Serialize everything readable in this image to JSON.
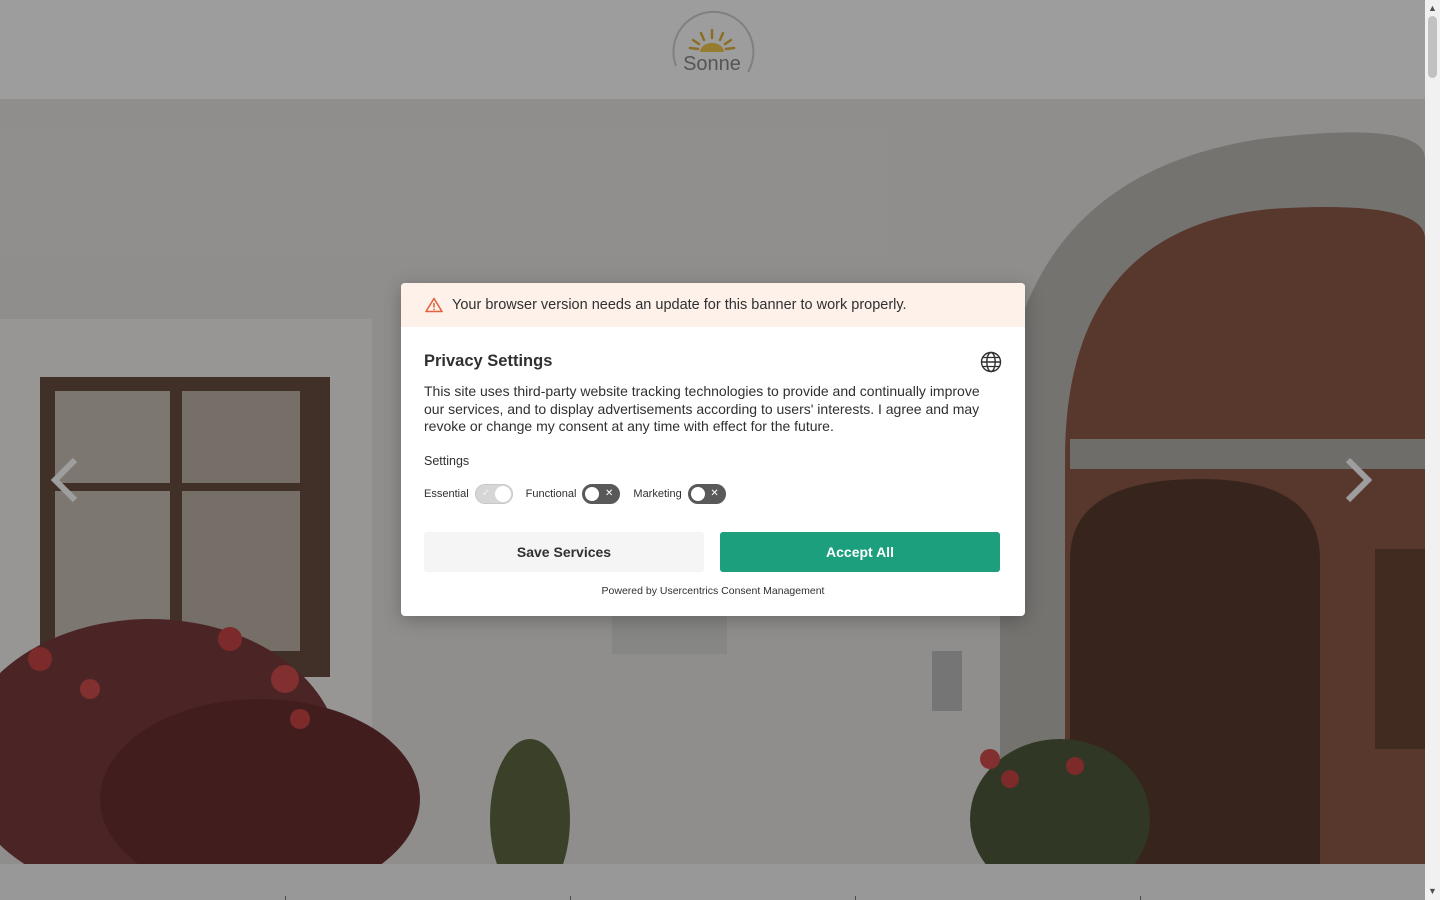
{
  "site": {
    "logo_text": "Sonne"
  },
  "banner": {
    "warning_text": "Your browser version needs an update for this banner to work properly.",
    "title": "Privacy Settings",
    "description": "This site uses third-party website tracking technologies to provide and continually improve our services, and to display advertisements according to users' interests. I agree and may revoke or change my consent at any time with effect for the future.",
    "settings_label": "Settings",
    "toggles": [
      {
        "label": "Essential",
        "state": "on",
        "disabled": true
      },
      {
        "label": "Functional",
        "state": "off",
        "disabled": false
      },
      {
        "label": "Marketing",
        "state": "off",
        "disabled": false
      }
    ],
    "save_label": "Save Services",
    "accept_label": "Accept All",
    "powered_by": "Powered by Usercentrics Consent Management"
  },
  "colors": {
    "accent": "#1b9f7c",
    "warning_bg": "#fdf1ea",
    "warning_icon": "#e4633d"
  },
  "icons": {
    "warning": "warning-triangle-icon",
    "language": "globe-icon",
    "prev": "chevron-left-icon",
    "next": "chevron-right-icon"
  }
}
